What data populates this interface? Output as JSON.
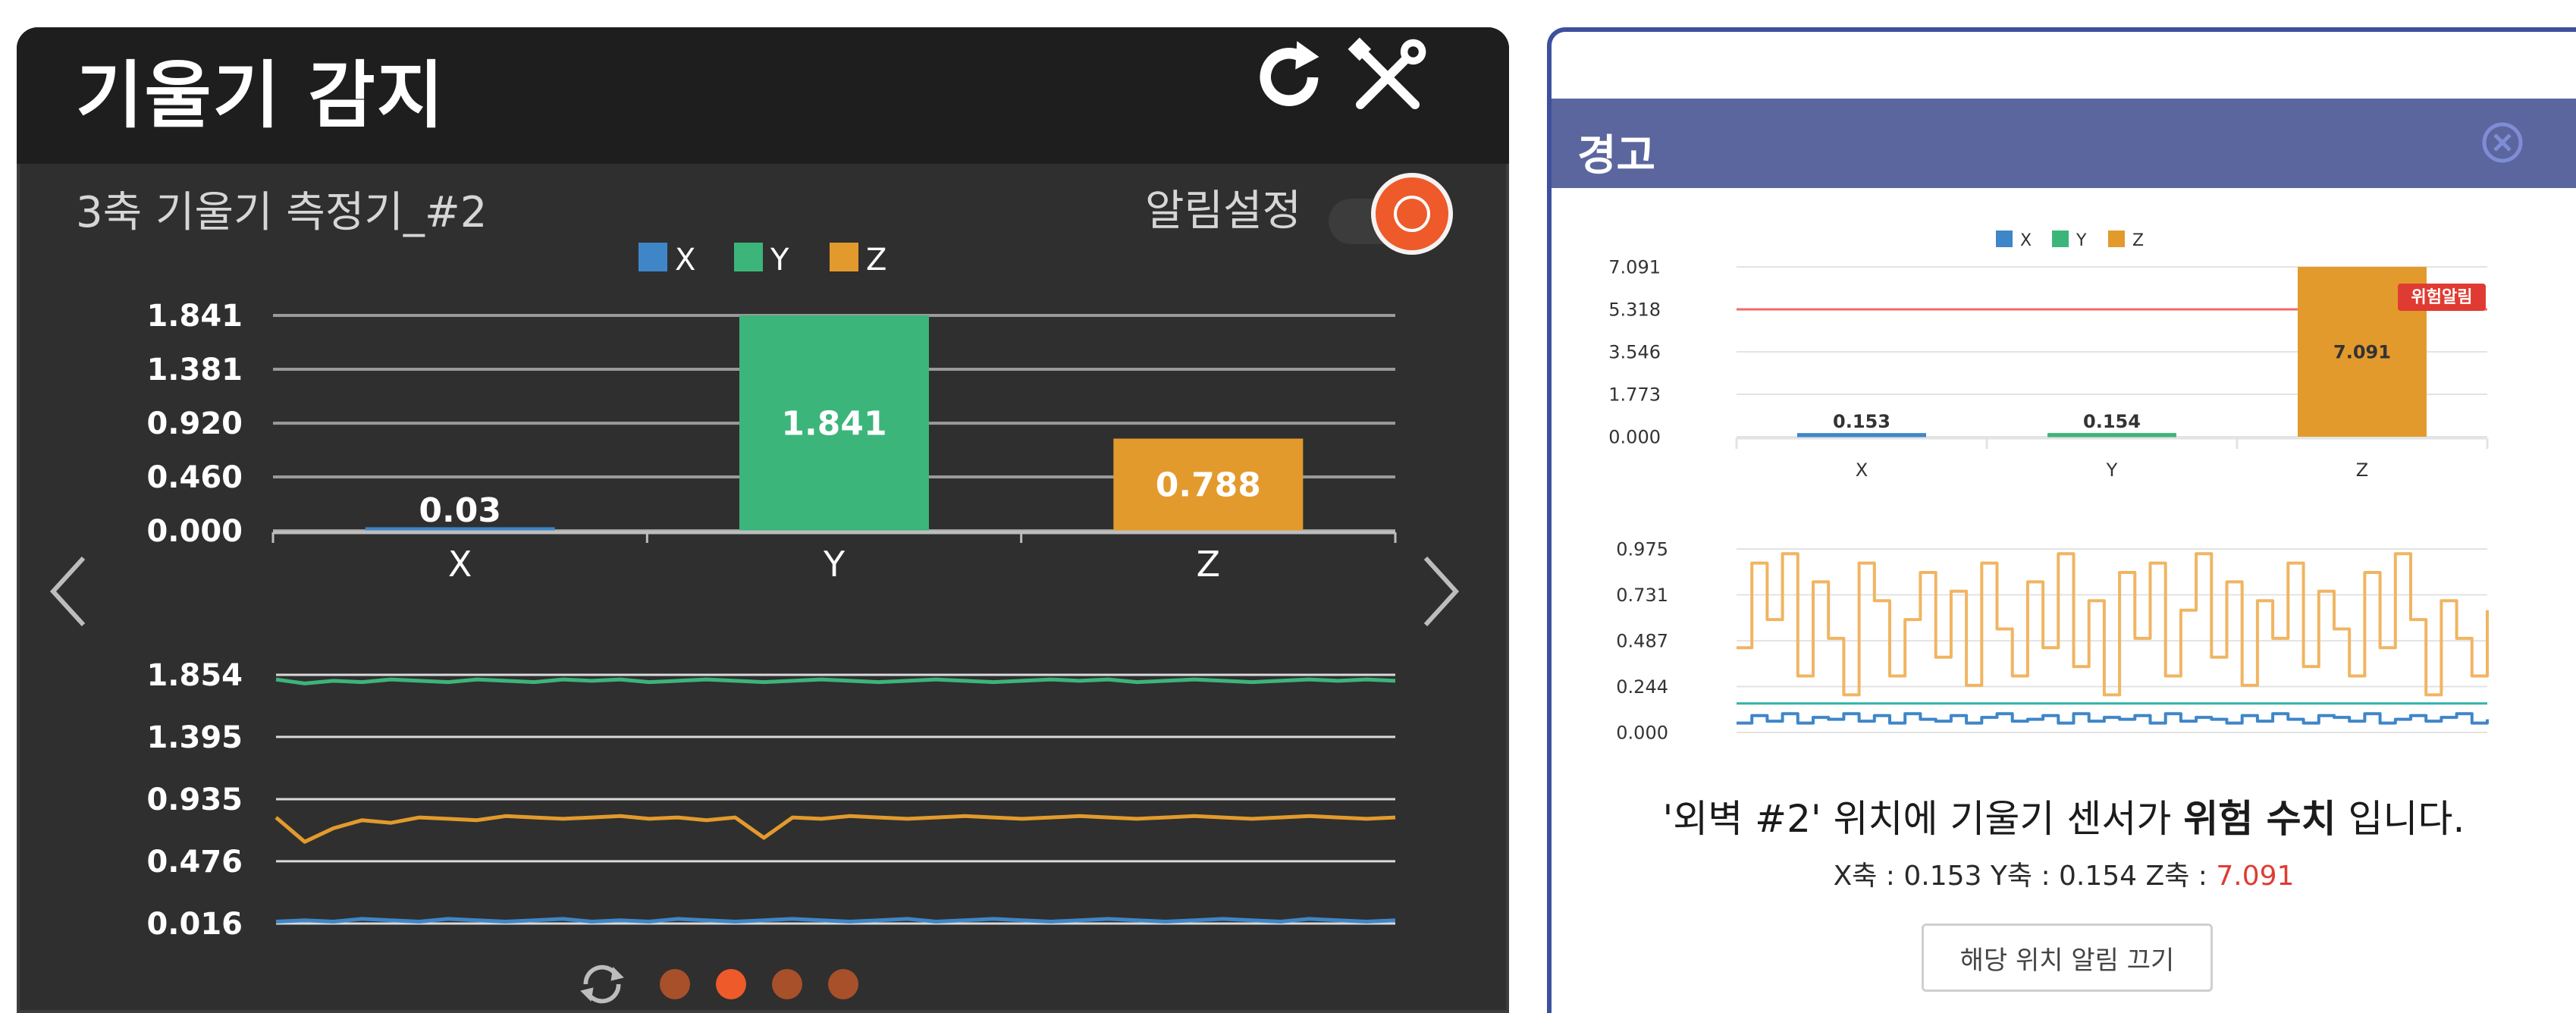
{
  "left_panel": {
    "title": "기울기 감지",
    "sensor_name": "3축 기울기 측정기_#2",
    "alarm_label": "알림설정",
    "icons": {
      "refresh": "refresh-icon",
      "settings": "tools-icon",
      "prev": "chevron-left-icon",
      "next": "chevron-right-icon",
      "carousel": "sync-icon"
    },
    "pager": {
      "pages": 4,
      "active_index": 1
    },
    "colors": {
      "x": "#3f86c8",
      "y": "#3cb57a",
      "z": "#e39a2c",
      "background": "#2f2f2f",
      "header": "#1e1e1e",
      "accent": "#ee5a2a"
    }
  },
  "chart_data": [
    {
      "type": "bar",
      "legend": [
        "X",
        "Y",
        "Z"
      ],
      "categories": [
        "X",
        "Y",
        "Z"
      ],
      "values": [
        0.03,
        1.841,
        0.788
      ],
      "value_labels": [
        "0.03",
        "1.841",
        "0.788"
      ],
      "yticks": [
        "1.841",
        "1.381",
        "0.920",
        "0.460",
        "0.000"
      ],
      "ylim": [
        0,
        1.841
      ],
      "grid": true,
      "legend_position": "top-center"
    },
    {
      "type": "line",
      "yticks": [
        "1.854",
        "1.395",
        "0.935",
        "0.476",
        "0.016"
      ],
      "ylim": [
        0.016,
        1.854
      ],
      "series": [
        {
          "name": "Y",
          "values": [
            1.82,
            1.79,
            1.81,
            1.8,
            1.82,
            1.81,
            1.8,
            1.82,
            1.81,
            1.8,
            1.82,
            1.81,
            1.82,
            1.8,
            1.81,
            1.82,
            1.81,
            1.8,
            1.81,
            1.82,
            1.81,
            1.8,
            1.81,
            1.82,
            1.81,
            1.8,
            1.81,
            1.82,
            1.81,
            1.82,
            1.8,
            1.81,
            1.82,
            1.81,
            1.8,
            1.81,
            1.82,
            1.81,
            1.82,
            1.81
          ]
        },
        {
          "name": "Z",
          "values": [
            0.8,
            0.62,
            0.72,
            0.78,
            0.76,
            0.8,
            0.79,
            0.78,
            0.81,
            0.8,
            0.79,
            0.8,
            0.81,
            0.79,
            0.8,
            0.78,
            0.8,
            0.65,
            0.8,
            0.79,
            0.81,
            0.8,
            0.79,
            0.8,
            0.81,
            0.8,
            0.79,
            0.8,
            0.81,
            0.8,
            0.79,
            0.8,
            0.81,
            0.8,
            0.79,
            0.8,
            0.81,
            0.8,
            0.79,
            0.8
          ]
        },
        {
          "name": "X",
          "values": [
            0.03,
            0.04,
            0.03,
            0.05,
            0.04,
            0.03,
            0.05,
            0.04,
            0.03,
            0.04,
            0.05,
            0.03,
            0.04,
            0.03,
            0.05,
            0.04,
            0.03,
            0.04,
            0.05,
            0.04,
            0.03,
            0.04,
            0.05,
            0.03,
            0.04,
            0.05,
            0.04,
            0.03,
            0.04,
            0.05,
            0.04,
            0.03,
            0.04,
            0.05,
            0.04,
            0.03,
            0.05,
            0.04,
            0.03,
            0.04
          ]
        }
      ],
      "grid": true
    },
    {
      "type": "bar",
      "legend": [
        "X",
        "Y",
        "Z"
      ],
      "categories": [
        "X",
        "Y",
        "Z"
      ],
      "values": [
        0.153,
        0.154,
        7.091
      ],
      "value_labels": [
        "0.153",
        "0.154",
        "7.091"
      ],
      "yticks": [
        "7.091",
        "5.318",
        "3.546",
        "1.773",
        "0.000"
      ],
      "ylim": [
        0,
        7.091
      ],
      "threshold": {
        "value": 5.318,
        "label": "위험알림"
      },
      "grid": true,
      "legend_position": "top-center"
    },
    {
      "type": "line",
      "yticks": [
        "0.975",
        "0.731",
        "0.487",
        "0.244",
        "0.000"
      ],
      "ylim": [
        0,
        0.975
      ],
      "series": [
        {
          "name": "Z",
          "values": [
            0.45,
            0.9,
            0.6,
            0.95,
            0.3,
            0.8,
            0.5,
            0.2,
            0.9,
            0.7,
            0.3,
            0.6,
            0.85,
            0.4,
            0.75,
            0.25,
            0.9,
            0.55,
            0.3,
            0.8,
            0.45,
            0.95,
            0.35,
            0.7,
            0.2,
            0.85,
            0.5,
            0.9,
            0.3,
            0.65,
            0.95,
            0.4,
            0.8,
            0.25,
            0.7,
            0.5,
            0.9,
            0.35,
            0.75,
            0.55,
            0.3,
            0.85,
            0.45,
            0.95,
            0.6,
            0.2,
            0.7,
            0.5,
            0.3,
            0.65
          ]
        },
        {
          "name": "X",
          "values": [
            0.05,
            0.09,
            0.06,
            0.1,
            0.05,
            0.08,
            0.07,
            0.1,
            0.06,
            0.09,
            0.05,
            0.1,
            0.07,
            0.06,
            0.09,
            0.05,
            0.08,
            0.1,
            0.06,
            0.07,
            0.09,
            0.05,
            0.1,
            0.06,
            0.08,
            0.07,
            0.09,
            0.05,
            0.1,
            0.06,
            0.08,
            0.07,
            0.05,
            0.09,
            0.06,
            0.1,
            0.07,
            0.05,
            0.09,
            0.08,
            0.06,
            0.1,
            0.05,
            0.07,
            0.09,
            0.06,
            0.08,
            0.1,
            0.05,
            0.07
          ]
        }
      ],
      "threshold": {
        "value": 0.154
      },
      "grid": true
    }
  ],
  "right_panel": {
    "title": "경고",
    "close_icon": "close-circle-icon",
    "colors": {
      "header": "#5b669e",
      "border": "#3e4f9c",
      "danger": "#e03b32",
      "threshold": "#f06a6a"
    },
    "message": {
      "prefix": "'외벽 #2' 위치에 기울기 센서가 ",
      "emphasis": "위험 수치",
      "suffix": " 입니다."
    },
    "values": {
      "x": "X축 : 0.153",
      "y": "Y축 : 0.154",
      "z_label": "Z축 : ",
      "z_value": "7.091"
    },
    "off_button_label": "해당 위치 알림 끄기"
  }
}
